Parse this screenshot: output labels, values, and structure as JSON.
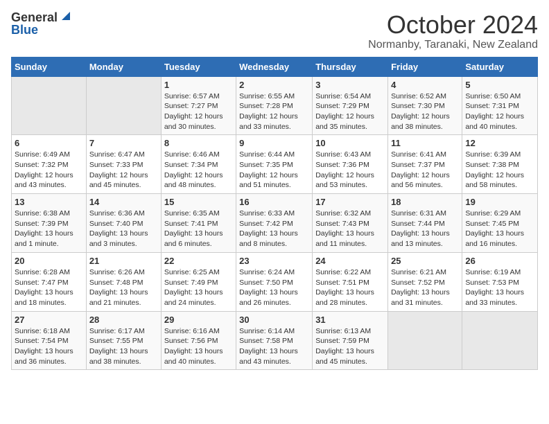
{
  "header": {
    "logo_general": "General",
    "logo_blue": "Blue",
    "title": "October 2024",
    "location": "Normanby, Taranaki, New Zealand"
  },
  "days_of_week": [
    "Sunday",
    "Monday",
    "Tuesday",
    "Wednesday",
    "Thursday",
    "Friday",
    "Saturday"
  ],
  "weeks": [
    [
      {
        "day": "",
        "info": ""
      },
      {
        "day": "",
        "info": ""
      },
      {
        "day": "1",
        "info": "Sunrise: 6:57 AM\nSunset: 7:27 PM\nDaylight: 12 hours and 30 minutes."
      },
      {
        "day": "2",
        "info": "Sunrise: 6:55 AM\nSunset: 7:28 PM\nDaylight: 12 hours and 33 minutes."
      },
      {
        "day": "3",
        "info": "Sunrise: 6:54 AM\nSunset: 7:29 PM\nDaylight: 12 hours and 35 minutes."
      },
      {
        "day": "4",
        "info": "Sunrise: 6:52 AM\nSunset: 7:30 PM\nDaylight: 12 hours and 38 minutes."
      },
      {
        "day": "5",
        "info": "Sunrise: 6:50 AM\nSunset: 7:31 PM\nDaylight: 12 hours and 40 minutes."
      }
    ],
    [
      {
        "day": "6",
        "info": "Sunrise: 6:49 AM\nSunset: 7:32 PM\nDaylight: 12 hours and 43 minutes."
      },
      {
        "day": "7",
        "info": "Sunrise: 6:47 AM\nSunset: 7:33 PM\nDaylight: 12 hours and 45 minutes."
      },
      {
        "day": "8",
        "info": "Sunrise: 6:46 AM\nSunset: 7:34 PM\nDaylight: 12 hours and 48 minutes."
      },
      {
        "day": "9",
        "info": "Sunrise: 6:44 AM\nSunset: 7:35 PM\nDaylight: 12 hours and 51 minutes."
      },
      {
        "day": "10",
        "info": "Sunrise: 6:43 AM\nSunset: 7:36 PM\nDaylight: 12 hours and 53 minutes."
      },
      {
        "day": "11",
        "info": "Sunrise: 6:41 AM\nSunset: 7:37 PM\nDaylight: 12 hours and 56 minutes."
      },
      {
        "day": "12",
        "info": "Sunrise: 6:39 AM\nSunset: 7:38 PM\nDaylight: 12 hours and 58 minutes."
      }
    ],
    [
      {
        "day": "13",
        "info": "Sunrise: 6:38 AM\nSunset: 7:39 PM\nDaylight: 13 hours and 1 minute."
      },
      {
        "day": "14",
        "info": "Sunrise: 6:36 AM\nSunset: 7:40 PM\nDaylight: 13 hours and 3 minutes."
      },
      {
        "day": "15",
        "info": "Sunrise: 6:35 AM\nSunset: 7:41 PM\nDaylight: 13 hours and 6 minutes."
      },
      {
        "day": "16",
        "info": "Sunrise: 6:33 AM\nSunset: 7:42 PM\nDaylight: 13 hours and 8 minutes."
      },
      {
        "day": "17",
        "info": "Sunrise: 6:32 AM\nSunset: 7:43 PM\nDaylight: 13 hours and 11 minutes."
      },
      {
        "day": "18",
        "info": "Sunrise: 6:31 AM\nSunset: 7:44 PM\nDaylight: 13 hours and 13 minutes."
      },
      {
        "day": "19",
        "info": "Sunrise: 6:29 AM\nSunset: 7:45 PM\nDaylight: 13 hours and 16 minutes."
      }
    ],
    [
      {
        "day": "20",
        "info": "Sunrise: 6:28 AM\nSunset: 7:47 PM\nDaylight: 13 hours and 18 minutes."
      },
      {
        "day": "21",
        "info": "Sunrise: 6:26 AM\nSunset: 7:48 PM\nDaylight: 13 hours and 21 minutes."
      },
      {
        "day": "22",
        "info": "Sunrise: 6:25 AM\nSunset: 7:49 PM\nDaylight: 13 hours and 24 minutes."
      },
      {
        "day": "23",
        "info": "Sunrise: 6:24 AM\nSunset: 7:50 PM\nDaylight: 13 hours and 26 minutes."
      },
      {
        "day": "24",
        "info": "Sunrise: 6:22 AM\nSunset: 7:51 PM\nDaylight: 13 hours and 28 minutes."
      },
      {
        "day": "25",
        "info": "Sunrise: 6:21 AM\nSunset: 7:52 PM\nDaylight: 13 hours and 31 minutes."
      },
      {
        "day": "26",
        "info": "Sunrise: 6:19 AM\nSunset: 7:53 PM\nDaylight: 13 hours and 33 minutes."
      }
    ],
    [
      {
        "day": "27",
        "info": "Sunrise: 6:18 AM\nSunset: 7:54 PM\nDaylight: 13 hours and 36 minutes."
      },
      {
        "day": "28",
        "info": "Sunrise: 6:17 AM\nSunset: 7:55 PM\nDaylight: 13 hours and 38 minutes."
      },
      {
        "day": "29",
        "info": "Sunrise: 6:16 AM\nSunset: 7:56 PM\nDaylight: 13 hours and 40 minutes."
      },
      {
        "day": "30",
        "info": "Sunrise: 6:14 AM\nSunset: 7:58 PM\nDaylight: 13 hours and 43 minutes."
      },
      {
        "day": "31",
        "info": "Sunrise: 6:13 AM\nSunset: 7:59 PM\nDaylight: 13 hours and 45 minutes."
      },
      {
        "day": "",
        "info": ""
      },
      {
        "day": "",
        "info": ""
      }
    ]
  ]
}
